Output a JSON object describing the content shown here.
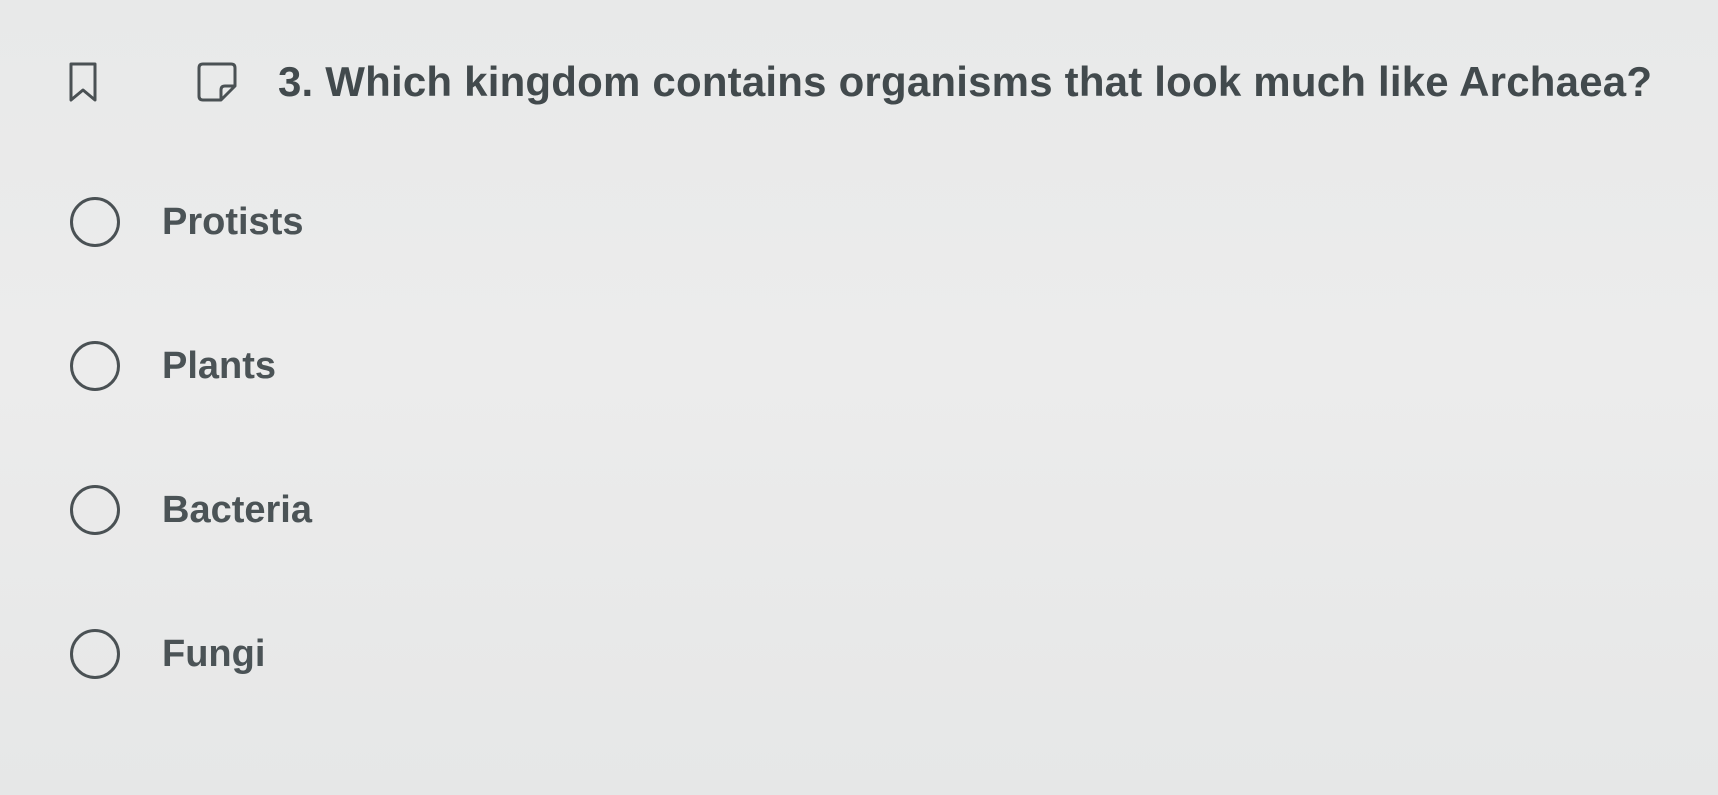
{
  "question": {
    "number": "3.",
    "text": "Which kingdom contains organisms that look much like Archaea?",
    "full": "3. Which kingdom contains organisms that look much like Archaea?"
  },
  "toolbar": {
    "bookmark_icon": "bookmark-icon",
    "note_icon": "note-icon"
  },
  "options": [
    {
      "label": "Protists",
      "selected": false
    },
    {
      "label": "Plants",
      "selected": false
    },
    {
      "label": "Bacteria",
      "selected": false
    },
    {
      "label": "Fungi",
      "selected": false
    }
  ],
  "colors": {
    "background": "#e9eaea",
    "text": "#424a4d",
    "radio_border": "#4a5154"
  }
}
